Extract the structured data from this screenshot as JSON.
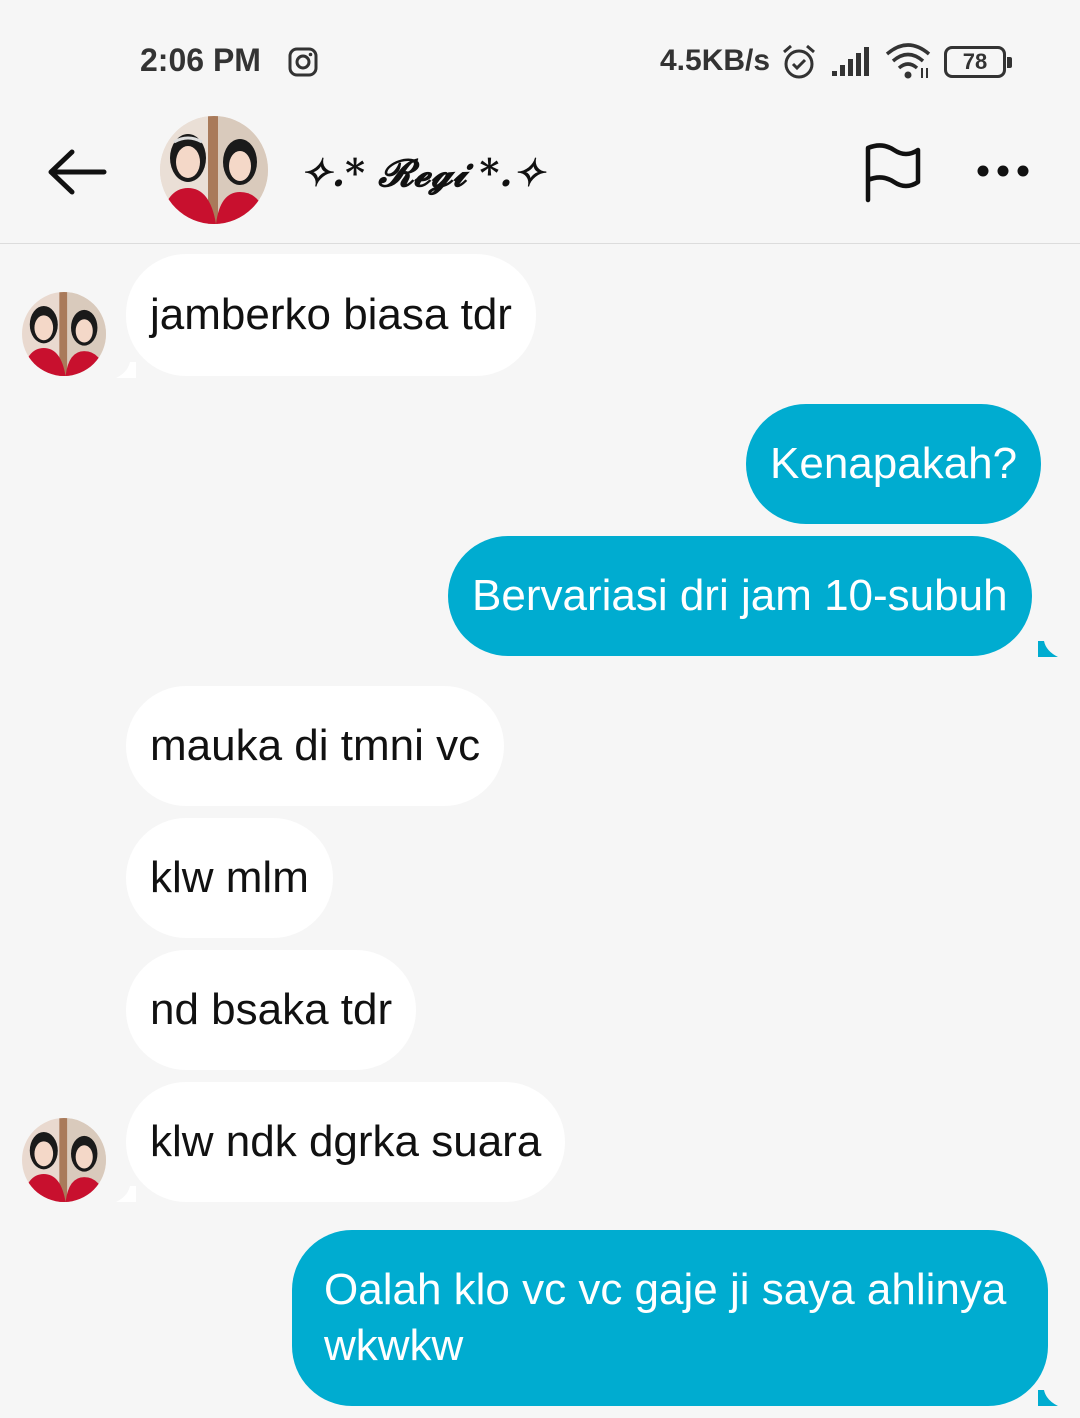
{
  "status_bar": {
    "time": "2:06 PM",
    "network_speed": "4.5KB/s",
    "battery": "78",
    "icons": [
      "instagram-icon",
      "alarm-icon",
      "signal-icon",
      "wifi-icon",
      "battery-icon"
    ]
  },
  "header": {
    "contact_name": "✧.* 𝓡𝓮𝓰𝓲 *.✧",
    "icons": [
      "back-arrow-icon",
      "flag-icon",
      "more-icon"
    ]
  },
  "colors": {
    "background": "#f6f6f6",
    "incoming_bubble": "#ffffff",
    "outgoing_bubble": "#00acd0"
  },
  "messages": [
    {
      "direction": "incoming",
      "text": "jamberko biasa tdr"
    },
    {
      "direction": "outgoing",
      "text": "Kenapakah?"
    },
    {
      "direction": "outgoing",
      "text": "Bervariasi dri jam 10-subuh"
    },
    {
      "direction": "incoming",
      "text": "mauka di tmni vc"
    },
    {
      "direction": "incoming",
      "text": "klw mlm"
    },
    {
      "direction": "incoming",
      "text": "nd bsaka tdr"
    },
    {
      "direction": "incoming",
      "text": "klw ndk dgrka suara"
    },
    {
      "direction": "outgoing",
      "text": "Oalah klo vc vc gaje ji saya ahlinya wkwkw"
    }
  ]
}
